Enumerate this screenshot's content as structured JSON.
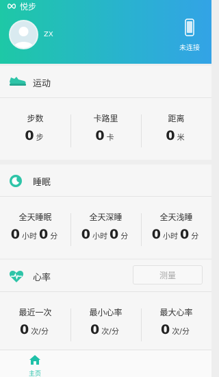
{
  "app": {
    "title": "悦步"
  },
  "user": {
    "name": "ZX"
  },
  "device": {
    "status": "未连接",
    "icon": "phone-icon"
  },
  "sport": {
    "title": "运动",
    "icon": "sneaker-icon",
    "stats": [
      {
        "label": "步数",
        "value": "0",
        "unit": "步"
      },
      {
        "label": "卡路里",
        "value": "0",
        "unit": "卡"
      },
      {
        "label": "距离",
        "value": "0",
        "unit": "米"
      }
    ]
  },
  "sleep": {
    "title": "睡眠",
    "icon": "moon-icon",
    "stats": [
      {
        "label": "全天睡眠",
        "hours": "0",
        "hours_unit": "小时",
        "minutes": "0",
        "minutes_unit": "分"
      },
      {
        "label": "全天深睡",
        "hours": "0",
        "hours_unit": "小时",
        "minutes": "0",
        "minutes_unit": "分"
      },
      {
        "label": "全天浅睡",
        "hours": "0",
        "hours_unit": "小时",
        "minutes": "0",
        "minutes_unit": "分"
      }
    ]
  },
  "heart": {
    "title": "心率",
    "icon": "heart-pulse-icon",
    "measure_label": "测量",
    "stats": [
      {
        "label": "最近一次",
        "value": "0",
        "unit": "次/分"
      },
      {
        "label": "最小心率",
        "value": "0",
        "unit": "次/分"
      },
      {
        "label": "最大心率",
        "value": "0",
        "unit": "次/分"
      }
    ]
  },
  "tabbar": {
    "home_label": "主页"
  },
  "colors": {
    "accent": "#1ec8a6",
    "header_end": "#33a3e6",
    "heart": "#1fc0a8"
  }
}
